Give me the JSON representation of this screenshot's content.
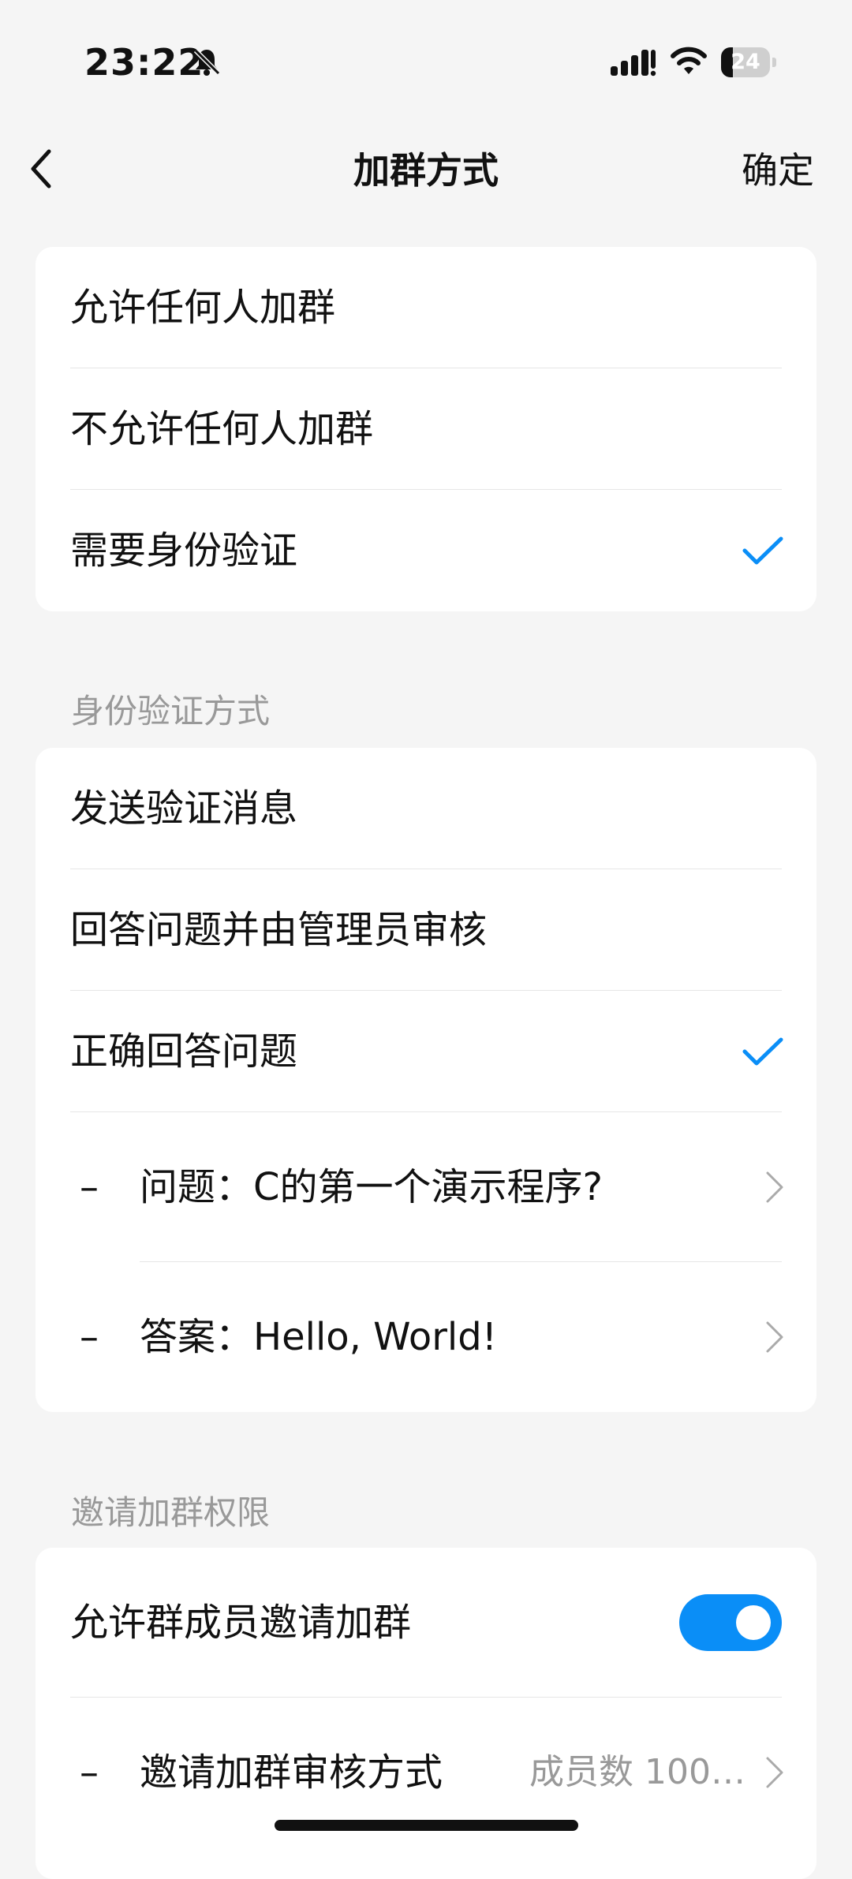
{
  "status_bar": {
    "time": "23:22",
    "battery": "24",
    "battery_level_percent": 24,
    "icons": [
      "bell-off-icon",
      "signal-icon",
      "wifi-icon",
      "battery-icon"
    ]
  },
  "nav": {
    "title": "加群方式",
    "confirm_label": "确定",
    "back_icon": "chevron-left-icon"
  },
  "join_options": {
    "items": [
      {
        "label": "允许任何人加群",
        "selected": false
      },
      {
        "label": "不允许任何人加群",
        "selected": false
      },
      {
        "label": "需要身份验证",
        "selected": true
      }
    ]
  },
  "verify_section": {
    "header": "身份验证方式",
    "items": [
      {
        "label": "发送验证消息",
        "selected": false
      },
      {
        "label": "回答问题并由管理员审核",
        "selected": false
      },
      {
        "label": "正确回答问题",
        "selected": true
      }
    ],
    "dash": "–",
    "question": "问题：C的第一个演示程序?",
    "answer": "答案：Hello, World!"
  },
  "invite_section": {
    "header": "邀请加群权限",
    "allow_invite_label": "允许群成员邀请加群",
    "allow_invite_on": true,
    "review_label": "邀请加群审核方式",
    "review_value": "成员数 100…"
  },
  "colors": {
    "accent": "#0a8ef7",
    "background": "#f5f5f5",
    "card": "#ffffff",
    "secondary_text": "#999999"
  }
}
